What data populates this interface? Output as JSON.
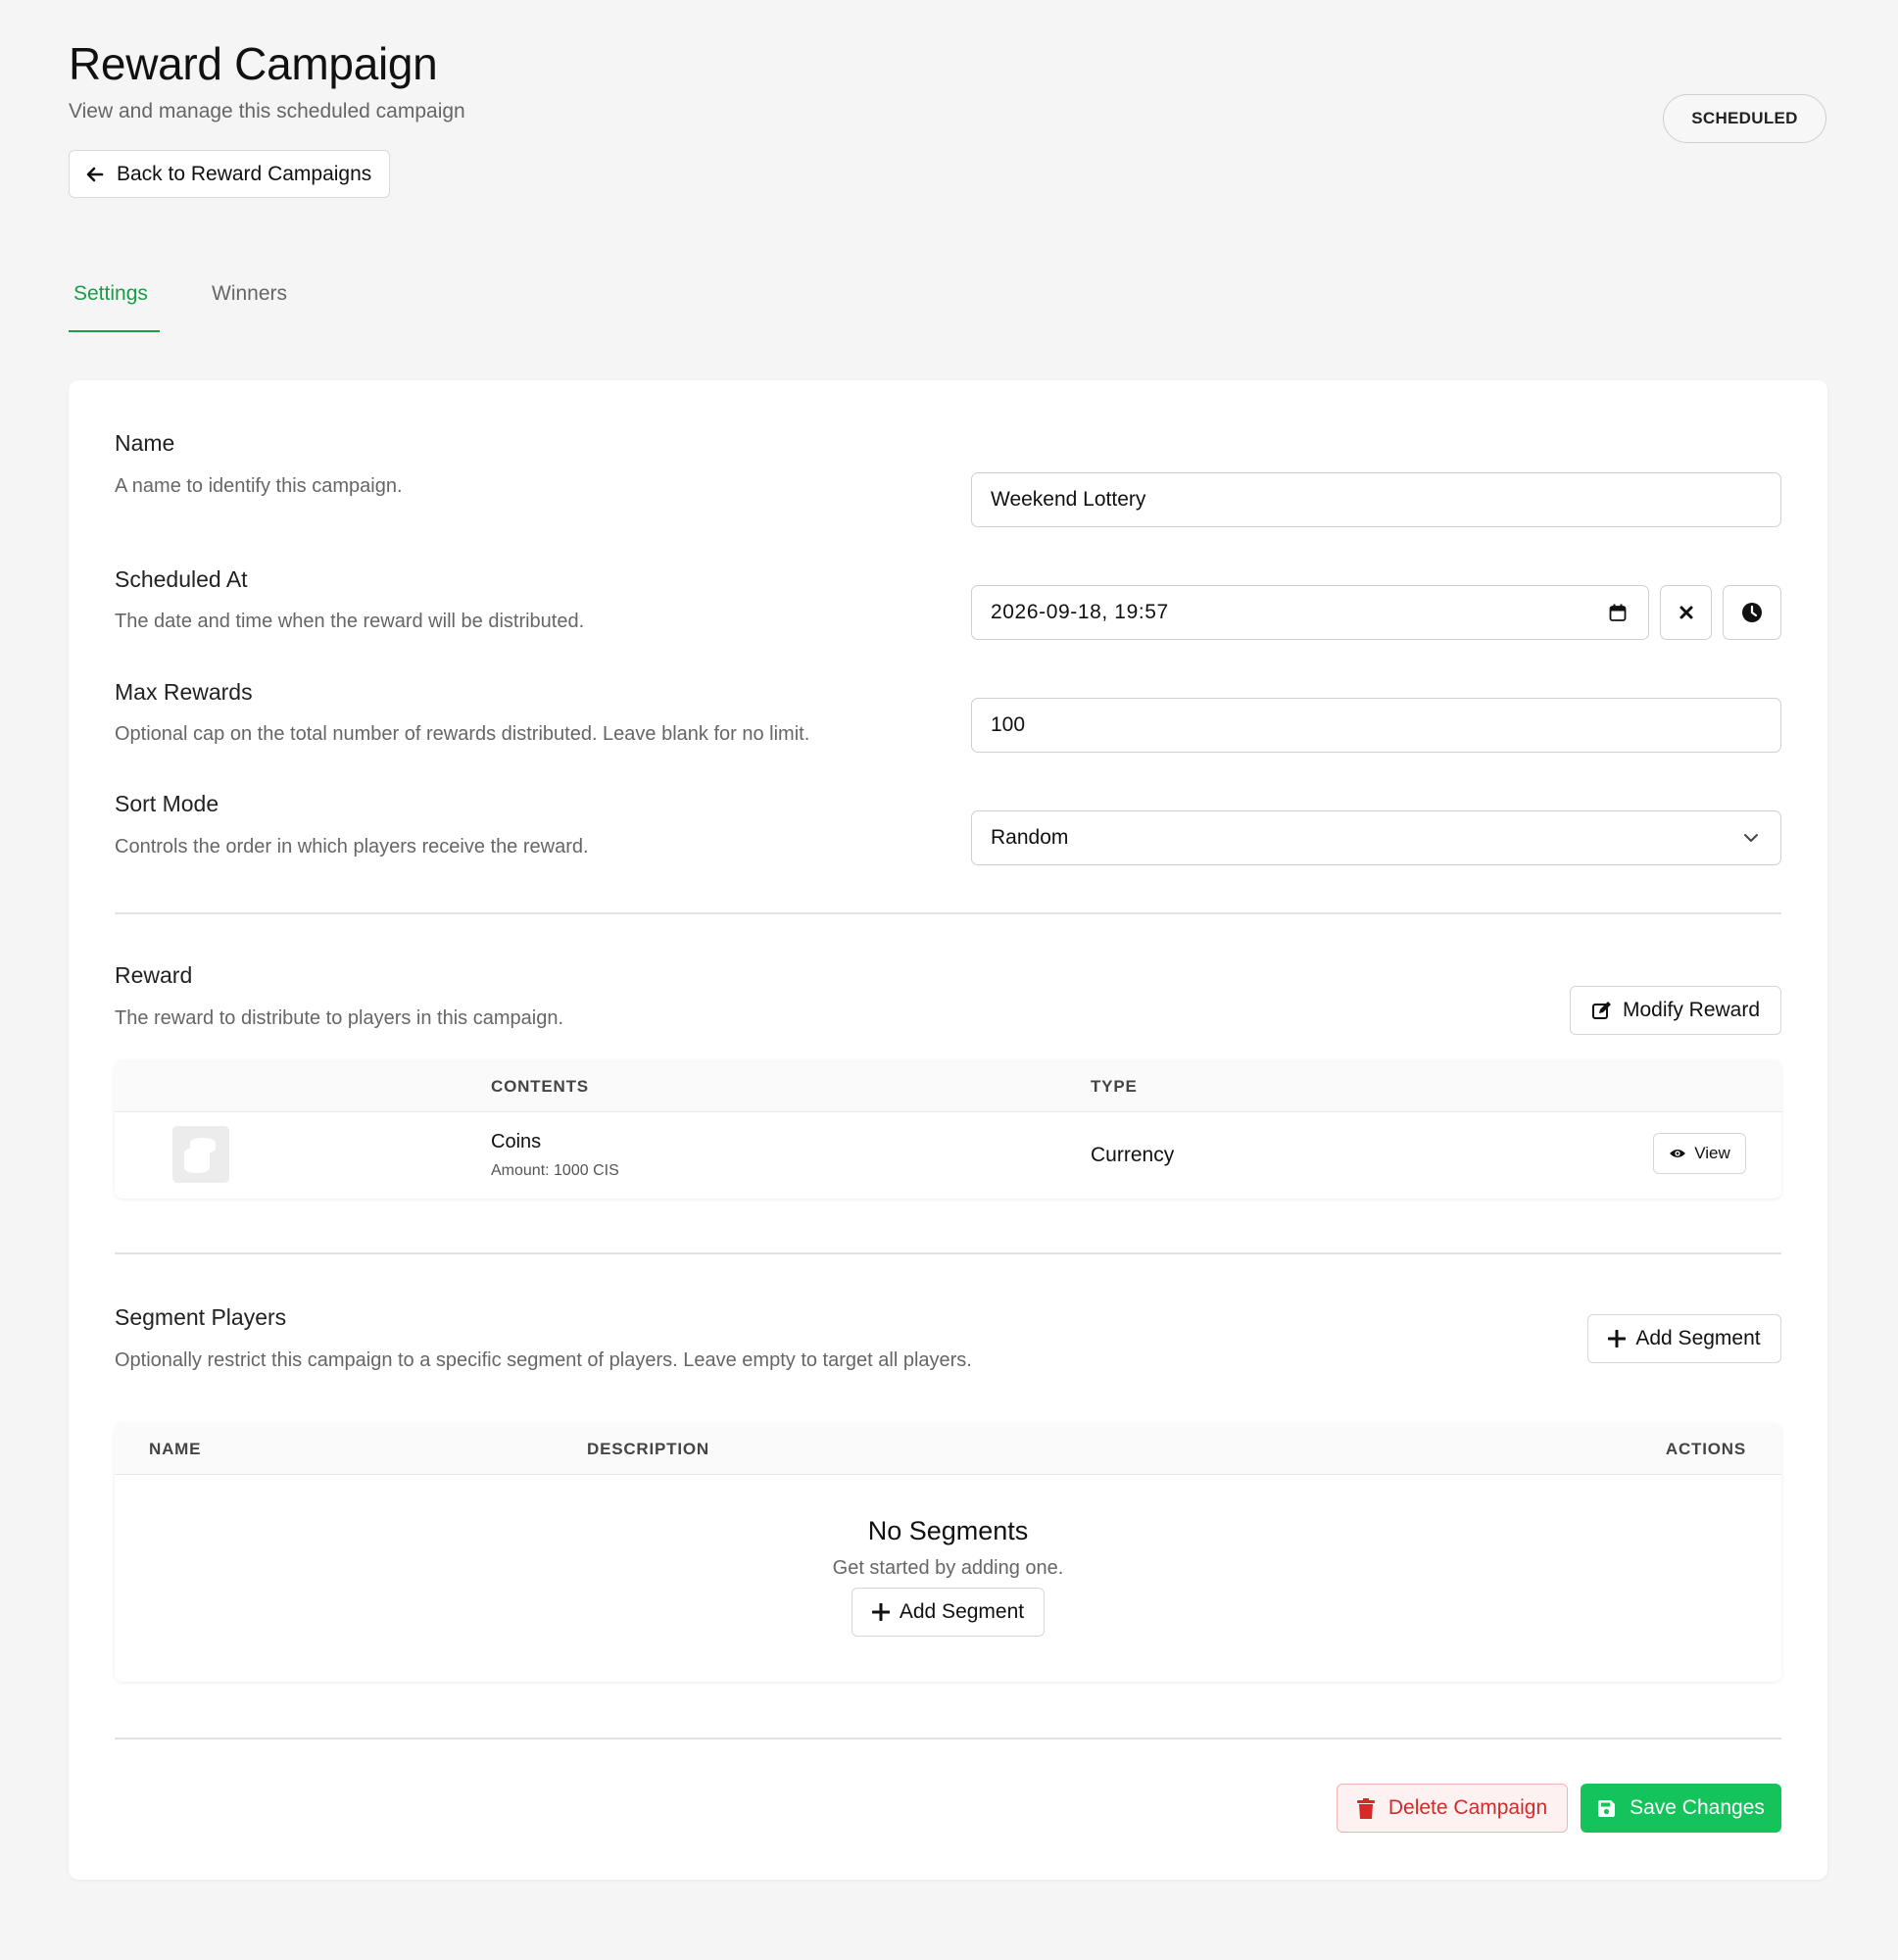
{
  "header": {
    "title": "Reward Campaign",
    "subtitle": "View and manage this scheduled campaign",
    "status": "SCHEDULED",
    "back_label": "Back to Reward Campaigns"
  },
  "tabs": [
    {
      "label": "Settings",
      "active": true
    },
    {
      "label": "Winners",
      "active": false
    }
  ],
  "form": {
    "name": {
      "label": "Name",
      "description": "A name to identify this campaign.",
      "value": "Weekend Lottery"
    },
    "scheduled_at": {
      "label": "Scheduled At",
      "description": "The date and time when the reward will be distributed.",
      "value": "2026-09-18, 19:57"
    },
    "max_rewards": {
      "label": "Max Rewards",
      "description": "Optional cap on the total number of rewards distributed. Leave blank for no limit.",
      "value": "100"
    },
    "sort_mode": {
      "label": "Sort Mode",
      "description": "Controls the order in which players receive the reward.",
      "value": "Random"
    }
  },
  "reward": {
    "title": "Reward",
    "description": "The reward to distribute to players in this campaign.",
    "modify_label": "Modify Reward",
    "columns": [
      "CONTENTS",
      "TYPE"
    ],
    "rows": [
      {
        "name": "Coins",
        "amount": "Amount: 1000 CIS",
        "type": "Currency",
        "action": "View",
        "icon": "coins-icon"
      }
    ]
  },
  "segments": {
    "title": "Segment Players",
    "description": "Optionally restrict this campaign to a specific segment of players. Leave empty to target all players.",
    "add_label": "Add Segment",
    "columns": [
      "NAME",
      "DESCRIPTION",
      "ACTIONS"
    ],
    "empty_title": "No Segments",
    "empty_text": "Get started by adding one.",
    "empty_add_label": "Add Segment"
  },
  "footer": {
    "delete_label": "Delete Campaign",
    "save_label": "Save Changes"
  },
  "colors": {
    "accent": "#1a9c4a",
    "primary": "#14c45a",
    "danger": "#d42a2a"
  }
}
